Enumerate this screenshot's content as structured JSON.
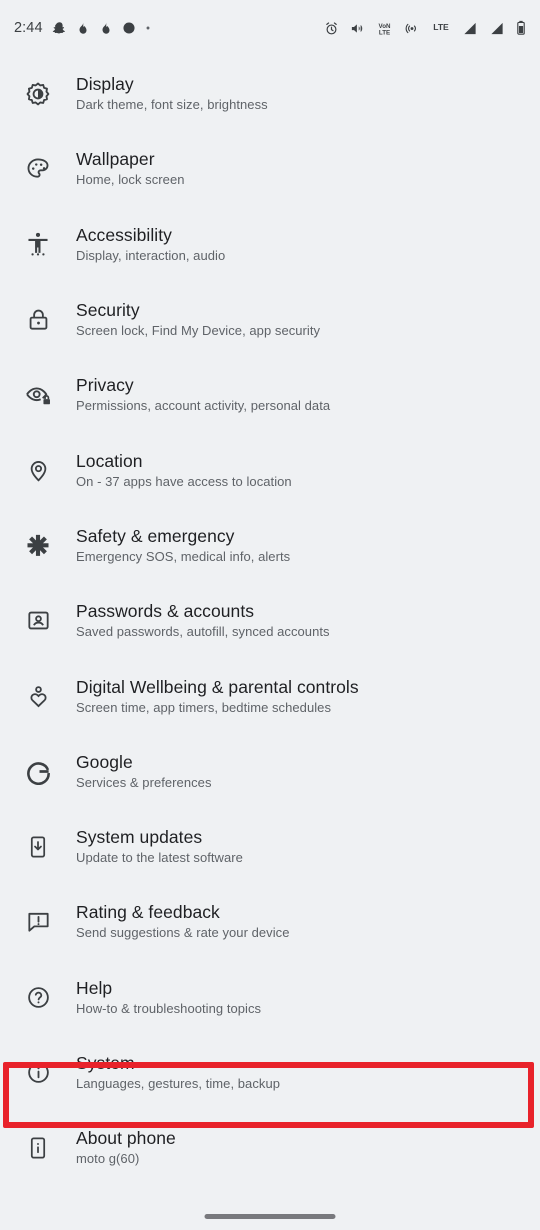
{
  "status_bar": {
    "clock": "2:44",
    "left_icons": [
      {
        "name": "snapchat-notification-icon",
        "glyph": "ghost"
      },
      {
        "name": "app-notification-icon-1",
        "glyph": "flame"
      },
      {
        "name": "app-notification-icon-2",
        "glyph": "flame"
      },
      {
        "name": "app-notification-icon-3",
        "glyph": "circle"
      },
      {
        "name": "more-notifications-dot-icon",
        "glyph": "dot"
      }
    ],
    "right_icons": [
      {
        "name": "alarm-icon",
        "label": "alarm"
      },
      {
        "name": "vibrate-icon",
        "label": "vibrate"
      },
      {
        "name": "volte-icon",
        "label": "VoLTE"
      },
      {
        "name": "hotspot-icon",
        "label": "hotspot"
      },
      {
        "name": "lte-label-icon",
        "label": "LTE"
      },
      {
        "name": "signal-bars-sim1-icon",
        "label": "signal 1"
      },
      {
        "name": "signal-bars-sim2-icon",
        "label": "signal 2"
      },
      {
        "name": "battery-icon",
        "label": "battery"
      }
    ]
  },
  "colors": {
    "background": "#eff1f3",
    "title_text": "#1f2023",
    "subtitle_text": "#5f6368",
    "icon": "#3c4043",
    "highlight": "#e8222a",
    "nav_pill": "#78797d"
  },
  "settings": {
    "items": [
      {
        "id": "display",
        "icon": "brightness-icon",
        "title": "Display",
        "subtitle": "Dark theme, font size, brightness",
        "highlighted": false
      },
      {
        "id": "wallpaper",
        "icon": "palette-icon",
        "title": "Wallpaper",
        "subtitle": "Home, lock screen",
        "highlighted": false
      },
      {
        "id": "accessibility",
        "icon": "accessibility-person-icon",
        "title": "Accessibility",
        "subtitle": "Display, interaction, audio",
        "highlighted": false
      },
      {
        "id": "security",
        "icon": "lock-icon",
        "title": "Security",
        "subtitle": "Screen lock, Find My Device, app security",
        "highlighted": false
      },
      {
        "id": "privacy",
        "icon": "eye-lock-icon",
        "title": "Privacy",
        "subtitle": "Permissions, account activity, personal data",
        "highlighted": false
      },
      {
        "id": "location",
        "icon": "location-pin-icon",
        "title": "Location",
        "subtitle": "On - 37 apps have access to location",
        "highlighted": false
      },
      {
        "id": "safety-emergency",
        "icon": "asterisk-emergency-icon",
        "title": "Safety & emergency",
        "subtitle": "Emergency SOS, medical info, alerts",
        "highlighted": false
      },
      {
        "id": "passwords-accounts",
        "icon": "account-card-icon",
        "title": "Passwords & accounts",
        "subtitle": "Saved passwords, autofill, synced accounts",
        "highlighted": false
      },
      {
        "id": "digital-wellbeing",
        "icon": "wellbeing-heart-icon",
        "title": "Digital Wellbeing & parental controls",
        "subtitle": "Screen time, app timers, bedtime schedules",
        "highlighted": false
      },
      {
        "id": "google",
        "icon": "google-g-icon",
        "title": "Google",
        "subtitle": "Services & preferences",
        "highlighted": false
      },
      {
        "id": "system-updates",
        "icon": "phone-download-icon",
        "title": "System updates",
        "subtitle": "Update to the latest software",
        "highlighted": false
      },
      {
        "id": "rating-feedback",
        "icon": "feedback-chat-icon",
        "title": "Rating & feedback",
        "subtitle": "Send suggestions & rate your device",
        "highlighted": false
      },
      {
        "id": "help",
        "icon": "help-question-icon",
        "title": "Help",
        "subtitle": "How-to & troubleshooting topics",
        "highlighted": false
      },
      {
        "id": "system",
        "icon": "info-circle-icon",
        "title": "System",
        "subtitle": "Languages, gestures, time, backup",
        "highlighted": true
      },
      {
        "id": "about-phone",
        "icon": "phone-info-icon",
        "title": "About phone",
        "subtitle": "moto g(60)",
        "highlighted": false
      }
    ]
  },
  "navigation": {
    "gesture_pill": "home-gesture-pill"
  }
}
